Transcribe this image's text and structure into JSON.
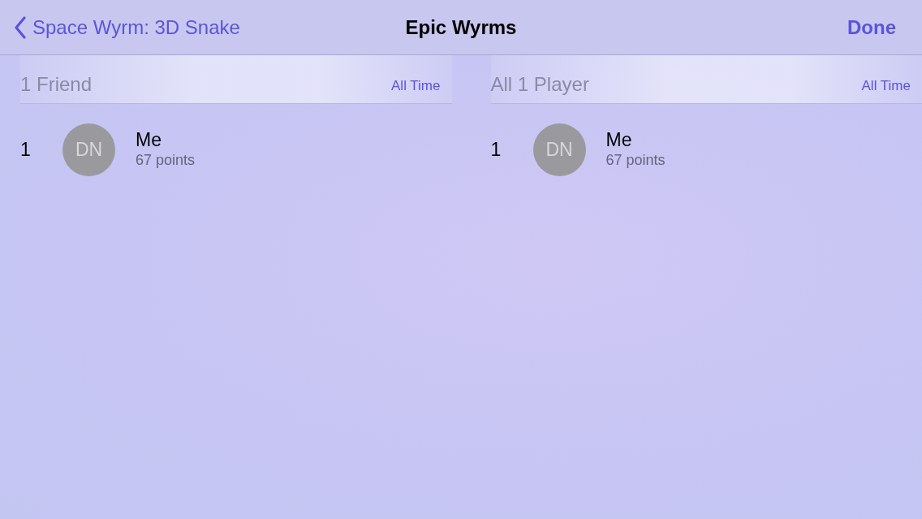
{
  "nav_bar": {
    "back_button": "Space Wyrm: 3D Snake",
    "title": "Epic Wyrms",
    "done_button": "Done"
  },
  "leaderboards": [
    {
      "heading": "1 Friend",
      "time_filter": "All Time",
      "rows": [
        {
          "rank": "1",
          "initials": "DN",
          "name": "Me",
          "score": "67 points"
        }
      ]
    },
    {
      "heading": "All 1 Player",
      "time_filter": "All Time",
      "rows": [
        {
          "rank": "1",
          "initials": "DN",
          "name": "Me",
          "score": "67 points"
        }
      ]
    }
  ]
}
